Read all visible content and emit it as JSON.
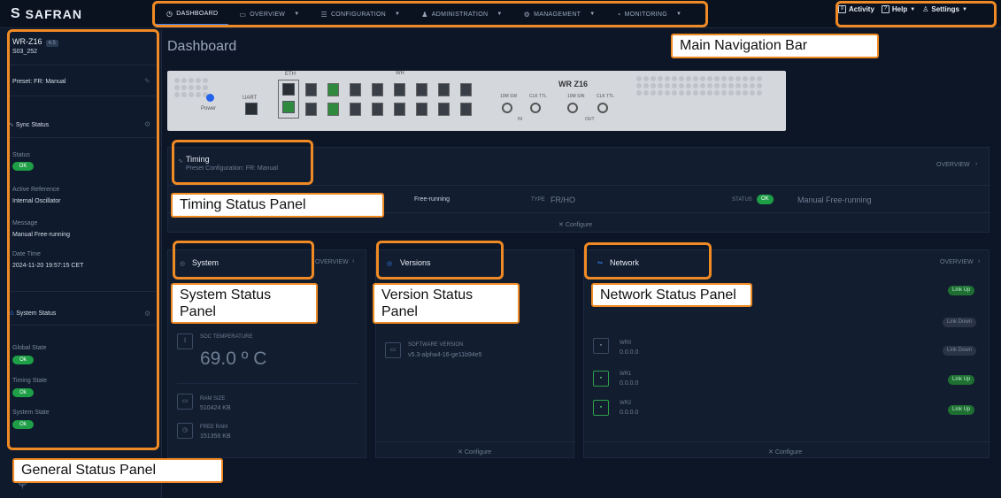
{
  "brand": {
    "name": "SAFRAN"
  },
  "nav": {
    "items": [
      {
        "label": "DASHBOARD",
        "icon": "dashboard-icon"
      },
      {
        "label": "OVERVIEW",
        "icon": "monitor-icon"
      },
      {
        "label": "CONFIGURATION",
        "icon": "sliders-icon"
      },
      {
        "label": "ADMINISTRATION",
        "icon": "users-icon"
      },
      {
        "label": "MANAGEMENT",
        "icon": "gear-icon"
      },
      {
        "label": "MONITORING",
        "icon": "gauge-icon"
      }
    ],
    "activity": "Activity",
    "help": "Help",
    "settings": "Settings"
  },
  "sidebar": {
    "device_name": "WR-Z16",
    "device_version": "4.5",
    "device_id": "S03_252",
    "preset": "Preset: FR: Manual",
    "sync_title": "Sync Status",
    "status_label": "Status",
    "status_value": "OK",
    "active_ref_label": "Active Reference",
    "active_ref_value": "Internal Oscillator",
    "message_label": "Message",
    "message_value": "Manual Free-running",
    "datetime_label": "Date Time",
    "datetime_value": "2024-11-20 19:57:15 CET",
    "system_title": "System Status",
    "global_label": "Global State",
    "global_value": "Ok",
    "timing_label": "Timing State",
    "timing_value": "Ok",
    "systemstate_label": "System State",
    "systemstate_value": "Ok"
  },
  "main": {
    "title": "Dashboard",
    "device": {
      "model": "WR Z16",
      "eth_label": "ETH",
      "wr_label": "WR",
      "power_label": "Power",
      "uart_label": "UART",
      "in_labels": [
        "10M SW",
        "CLK TTL"
      ],
      "out_labels": [
        "10M SIN",
        "CLK TTL"
      ],
      "in": "IN",
      "out": "OUT"
    },
    "timing": {
      "title": "Timing",
      "subtitle": "Preset Configuration: FR: Manual",
      "overview": "OVERVIEW",
      "mode": "Free-running",
      "type_label": "TYPE",
      "type_value": "FR/HO",
      "status_label": "STATUS",
      "status_value": "OK",
      "status_text": "Manual Free-running",
      "configure": "Configure"
    },
    "system": {
      "title": "System",
      "overview": "OVERVIEW",
      "soc_label": "SOC TEMPERATURE",
      "soc_value": "69.0 º C",
      "ram_label": "RAM SIZE",
      "ram_value": "510424 KB",
      "free_label": "FREE RAM",
      "free_value": "151356 KB"
    },
    "versions": {
      "title": "Versions",
      "sw_label": "SOFTWARE VERSION",
      "sw_value": "v5.3-alpha4-16-ge11b94e5",
      "configure": "Configure"
    },
    "network": {
      "title": "Network",
      "overview": "OVERVIEW",
      "ports": [
        {
          "name": "WR0",
          "ip": "0.0.0.0",
          "status": "Link Down"
        },
        {
          "name": "WR1",
          "ip": "0.0.0.0",
          "status": "Link Up"
        },
        {
          "name": "WR2",
          "ip": "0.0.0.0",
          "status": "Link Up"
        }
      ],
      "top_status_1": "Link Up",
      "top_status_2": "Link Down",
      "configure": "Configure"
    }
  },
  "annotations": {
    "main_nav": "Main Navigation Bar",
    "timing_panel": "Timing Status Panel",
    "system_panel": "System Status Panel",
    "version_panel": "Version Status Panel",
    "network_panel": "Network Status Panel",
    "general_panel": "General Status Panel"
  },
  "colors": {
    "accent": "#f08a24",
    "ok": "#1e9e46",
    "nav_active": "#3b82f6"
  }
}
